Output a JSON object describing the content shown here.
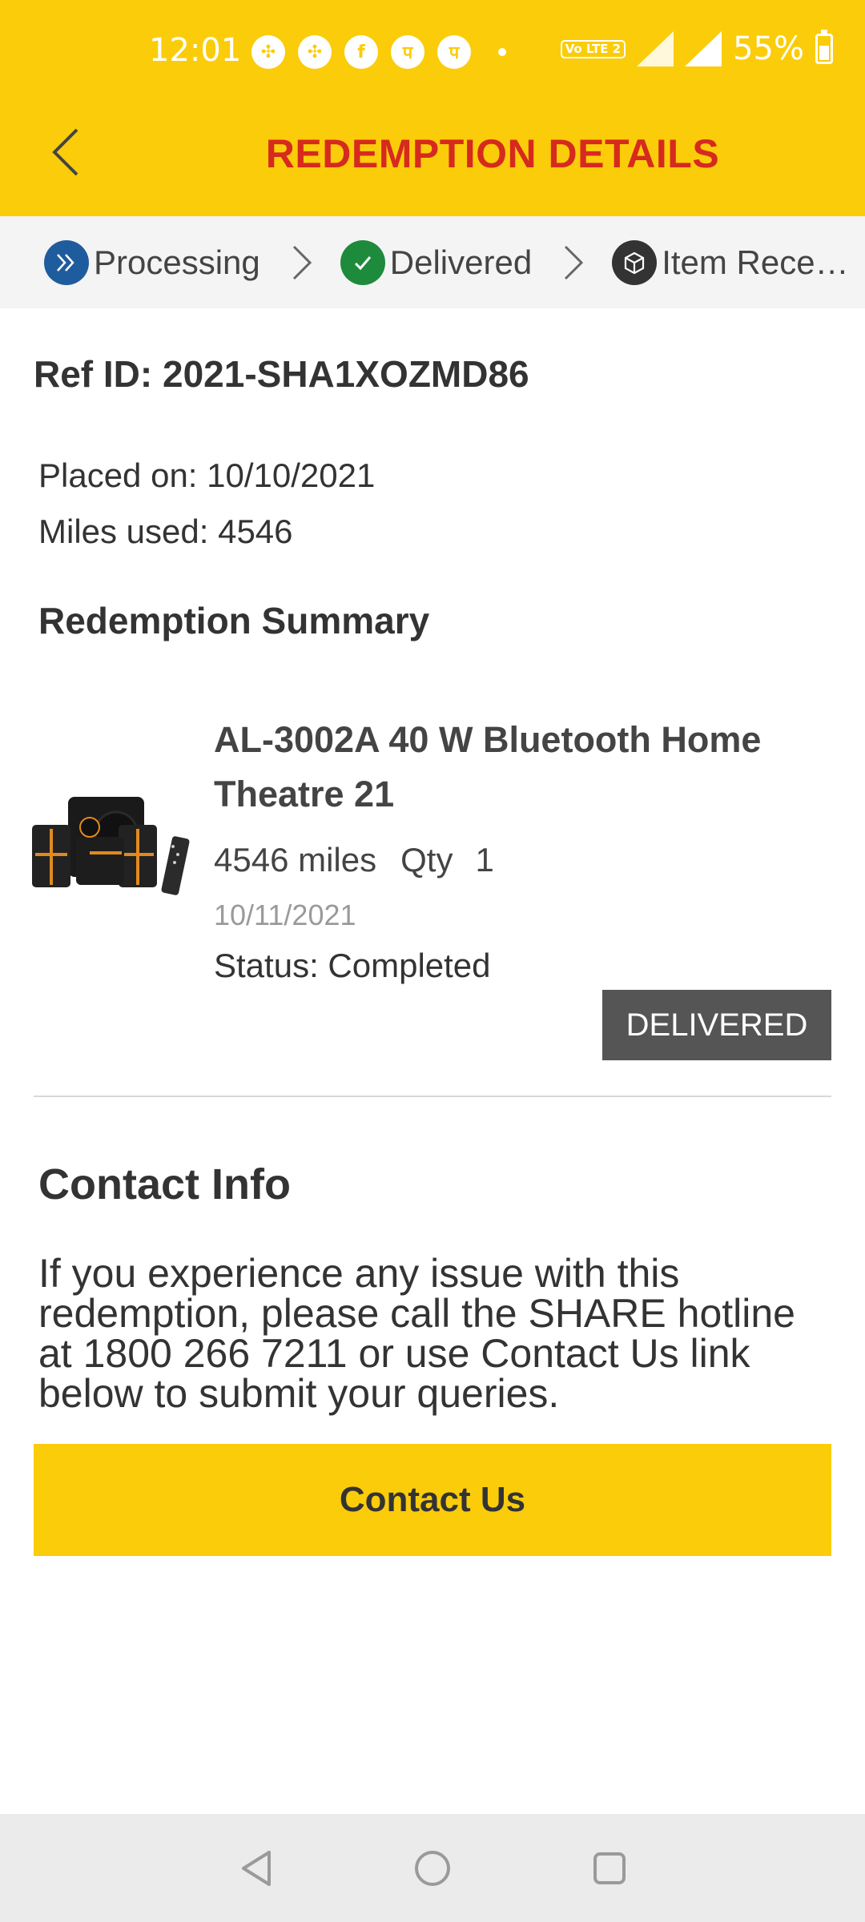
{
  "status_bar": {
    "time": "12:01",
    "icons": [
      "pinwheel-icon",
      "pinwheel-icon",
      "facebook-icon",
      "phonepe-icon",
      "phonepe-icon",
      "dot-icon"
    ],
    "volte_label": "Vo LTE 2",
    "network": "4G",
    "battery": "55%"
  },
  "header": {
    "title": "REDEMPTION DETAILS",
    "back_icon": "chevron-left-icon",
    "background": "#FBCC0A",
    "title_color": "#D62A1E"
  },
  "steps": [
    {
      "label": "Processing",
      "icon": "double-chevron-right-icon",
      "color": "#1F5C9E"
    },
    {
      "label": "Delivered",
      "icon": "check-icon",
      "color": "#1E8A3C"
    },
    {
      "label": "Item Rece…",
      "icon": "box-icon",
      "color": "#333333"
    }
  ],
  "order": {
    "ref_id": "Ref ID: 2021-SHA1XOZMD86",
    "placed_on": "Placed on: 10/10/2021",
    "miles_used": "Miles used: 4546",
    "summary_heading": "Redemption Summary"
  },
  "item": {
    "name": "AL-3002A 40 W Bluetooth Home Theatre 21",
    "miles": "4546 miles",
    "qty_label": "Qty",
    "qty": "1",
    "date": "10/11/2021",
    "status": "Status: Completed",
    "badge": "DELIVERED"
  },
  "contact": {
    "heading": "Contact Info",
    "text": "If you experience any issue with this redemption, please call the SHARE hotline at 1800 266 7211 or use Contact Us link below to submit your queries.",
    "button_label": "Contact Us"
  },
  "nav": [
    "back-triangle-icon",
    "home-circle-icon",
    "recents-square-icon"
  ]
}
